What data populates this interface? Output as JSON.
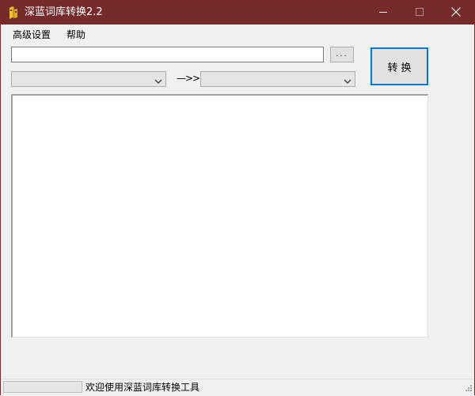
{
  "window": {
    "title": "深蓝词库转换2.2",
    "titlebar_color": "#762a2a"
  },
  "icons": {
    "app": "app-icon",
    "minimize": "minimize-icon",
    "maximize": "maximize-icon",
    "close": "close-icon",
    "dropdown": "chevron-down-icon",
    "grip": "resize-grip-icon"
  },
  "menu": {
    "items": [
      {
        "label": "高级设置"
      },
      {
        "label": "帮助"
      }
    ]
  },
  "toolbar": {
    "path_value": "",
    "browse_label": "...",
    "from_format": "",
    "to_format": "",
    "arrow_label": "—>>",
    "convert_label": "转换"
  },
  "output": {
    "text": ""
  },
  "status": {
    "progress": 0,
    "text": "欢迎使用深蓝词库转换工具"
  },
  "colors": {
    "accent_focus": "#0078d7"
  }
}
